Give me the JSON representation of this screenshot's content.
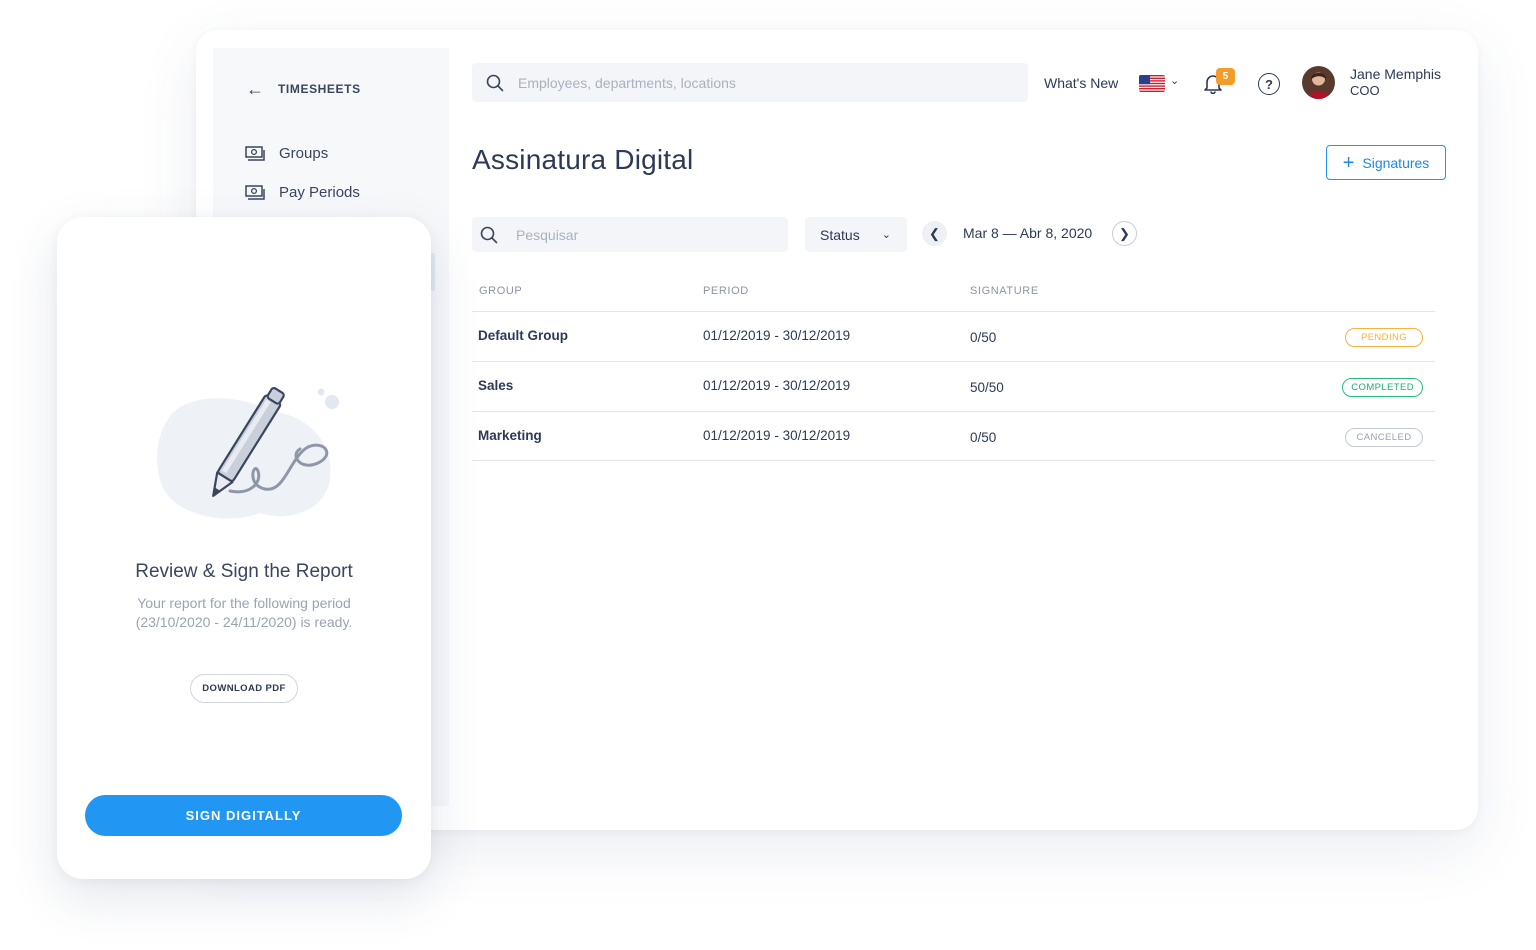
{
  "sidebar": {
    "back_label": "TIMESHEETS",
    "back_icon": "arrow-left-icon",
    "items": [
      {
        "label": "Groups",
        "icon": "money-icon"
      },
      {
        "label": "Pay Periods",
        "icon": "money-icon"
      }
    ]
  },
  "topbar": {
    "search_placeholder": "Employees, departments, locations",
    "whats_new": "What's New",
    "language_flag": "us-flag-icon",
    "notifications_count": "5",
    "help_label": "?",
    "user": {
      "name": "Jane Memphis",
      "role": "COO"
    }
  },
  "main": {
    "title": "Assinatura Digital",
    "add_button": "Signatures",
    "filters": {
      "search_placeholder": "Pesquisar",
      "status_label": "Status",
      "date_range": "Mar 8 — Abr 8, 2020"
    },
    "table": {
      "columns": [
        "GROUP",
        "PERIOD",
        "SIGNATURE"
      ],
      "rows": [
        {
          "group": "Default Group",
          "period": "01/12/2019 - 30/12/2019",
          "signature": "0/50",
          "status": "PENDING"
        },
        {
          "group": "Sales",
          "period": "01/12/2019 - 30/12/2019",
          "signature": "50/50",
          "status": "COMPLETED"
        },
        {
          "group": "Marketing",
          "period": "01/12/2019 - 30/12/2019",
          "signature": "0/50",
          "status": "CANCELED"
        }
      ]
    }
  },
  "mobile_card": {
    "title": "Review & Sign the Report",
    "description": "Your report for the following period (23/10/2020 - 24/11/2020) is ready.",
    "download_button": "DOWNLOAD PDF",
    "sign_button": "SIGN DIGITALLY"
  },
  "colors": {
    "accent": "#2196f3",
    "pending": "#f5b23c",
    "completed": "#27c07a",
    "canceled": "#b8bec9",
    "badge_orange": "#f39c2c"
  }
}
